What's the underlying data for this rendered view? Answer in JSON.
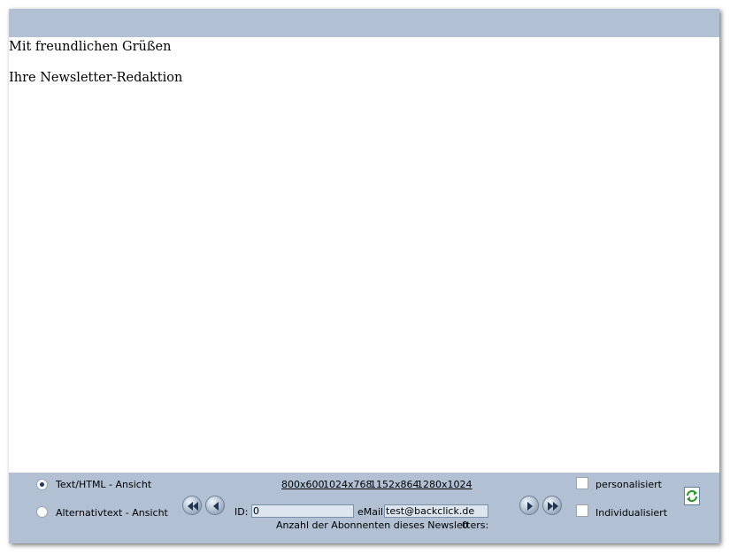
{
  "content": {
    "line1": "Mit freundlichen Grüßen",
    "line2": "Ihre Newsletter-Redaktion"
  },
  "controls": {
    "view_options": [
      {
        "label": "Text/HTML - Ansicht",
        "checked": true
      },
      {
        "label": "Alternativtext - Ansicht",
        "checked": false
      }
    ],
    "resolutions": [
      "800x600",
      "1024x768",
      "1152x864",
      "1280x1024"
    ],
    "id_label": "ID:",
    "id_value": "0",
    "email_label": "eMail:",
    "email_value": "test@backclick.de",
    "subscriber_count_label": "Anzahl der Abonnenten dieses Newsletters:",
    "subscriber_count_value": "0",
    "checkboxes": [
      {
        "label": "personalisiert",
        "checked": false
      },
      {
        "label": "Individualisiert",
        "checked": false
      }
    ],
    "nav_icons": [
      "first-icon",
      "previous-icon",
      "next-icon",
      "last-icon"
    ],
    "refresh_icon": "refresh-icon"
  },
  "colors": {
    "bar_background": "#b1c1d3",
    "refresh_arrows": "#2e9a2e",
    "field_background": "#dde5ef"
  }
}
